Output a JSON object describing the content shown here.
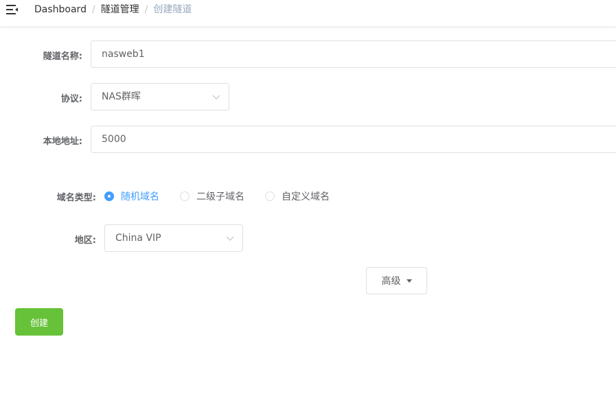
{
  "breadcrumb": {
    "items": [
      "Dashboard",
      "隧道管理",
      "创建隧道"
    ],
    "separator": "/"
  },
  "form": {
    "tunnel_name": {
      "label": "隧道名称:",
      "value": "nasweb1"
    },
    "protocol": {
      "label": "协议:",
      "value": "NAS群晖"
    },
    "local_address": {
      "label": "本地地址:",
      "value": "5000"
    },
    "domain_type": {
      "label": "域名类型:",
      "options": [
        "随机域名",
        "二级子域名",
        "自定义域名"
      ],
      "selected": "随机域名"
    },
    "region": {
      "label": "地区:",
      "value": "China VIP"
    }
  },
  "buttons": {
    "advanced": "高级",
    "create": "创建"
  },
  "colors": {
    "primary": "#409eff",
    "success": "#67c23a",
    "border": "#dcdfe6"
  },
  "icons": {
    "menu": "hamburger-fold-icon",
    "select": "chevron-down-icon",
    "dropdown": "caret-down-icon"
  }
}
